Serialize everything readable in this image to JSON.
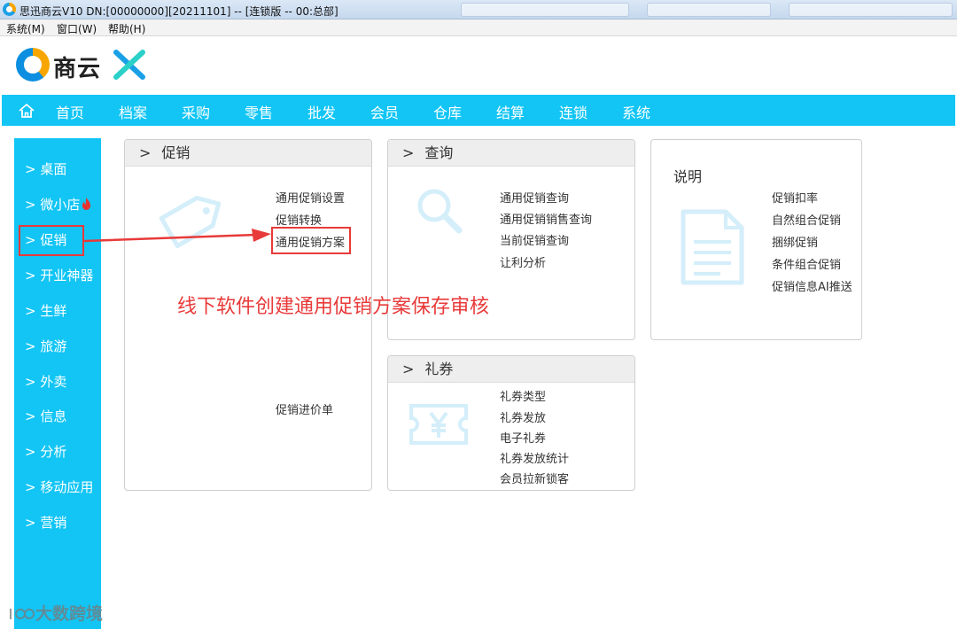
{
  "window": {
    "title": "思迅商云V10 DN:[00000000][20211101] -- [连锁版 -- 00:总部]"
  },
  "menubar": {
    "items": [
      "系统(M)",
      "窗口(W)",
      "帮助(H)"
    ]
  },
  "logo": {
    "text": "商云"
  },
  "nav": {
    "items": [
      "首页",
      "档案",
      "采购",
      "零售",
      "批发",
      "会员",
      "仓库",
      "结算",
      "连锁",
      "系统"
    ]
  },
  "sidebar": {
    "items": [
      "> 桌面",
      "> 微小店",
      "> 促销",
      "> 开业神器",
      "> 生鲜",
      "> 旅游",
      "> 外卖",
      "> 信息",
      "> 分析",
      "> 移动应用",
      "> 营销"
    ]
  },
  "panels": {
    "promo": {
      "chevron": ">",
      "title": "促销",
      "links": [
        "通用促销设置",
        "促销转换",
        "通用促销方案"
      ],
      "extra_link": "促销进价单"
    },
    "query": {
      "chevron": ">",
      "title": "查询",
      "links": [
        "通用促销查询",
        "通用促销销售查询",
        "当前促销查询",
        "让利分析"
      ]
    },
    "coupon": {
      "chevron": ">",
      "title": "礼券",
      "links": [
        "礼券类型",
        "礼券发放",
        "电子礼券",
        "礼券发放统计",
        "会员拉新锁客"
      ]
    },
    "explain": {
      "title": "说明",
      "links": [
        "促销扣率",
        "自然组合促销",
        "捆绑促销",
        "条件组合促销",
        "促销信息AI推送"
      ]
    }
  },
  "annotation": {
    "text": "线下软件创建通用促销方案保存审核"
  },
  "watermark": {
    "text": "大数跨境"
  },
  "colors": {
    "accent": "#12c5f5",
    "annotation": "#e83a3a",
    "deco_icon": "#d4eefa"
  }
}
